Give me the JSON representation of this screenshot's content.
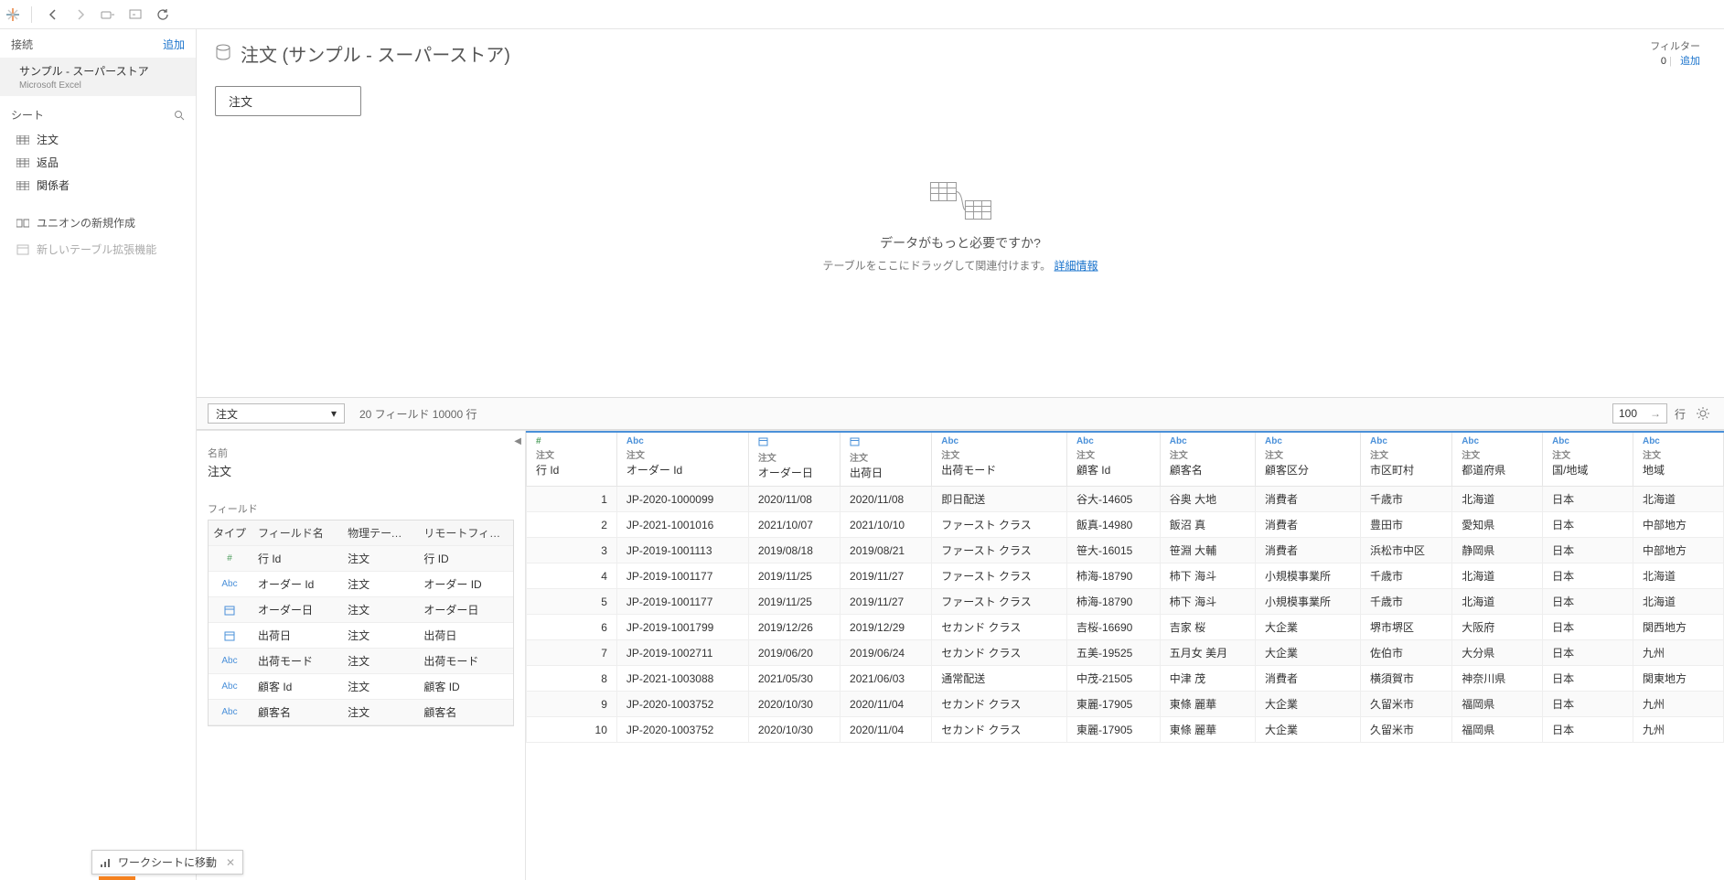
{
  "toolbar": {},
  "sidebar": {
    "connections_label": "接続",
    "add_label": "追加",
    "connection": {
      "name": "サンプル - スーパーストア",
      "type": "Microsoft Excel"
    },
    "sheets_label": "シート",
    "sheets": [
      {
        "label": "注文"
      },
      {
        "label": "返品"
      },
      {
        "label": "関係者"
      }
    ],
    "new_union_label": "ユニオンの新規作成",
    "new_table_ext_label": "新しいテーブル拡張機能"
  },
  "datasource": {
    "title": "注文 (サンプル - スーパーストア)",
    "filter_label": "フィルター",
    "filter_count": "0",
    "filter_add": "追加"
  },
  "canvas": {
    "table_pill": "注文",
    "need_more_q": "データがもっと必要ですか?",
    "need_more_hint_prefix": "テーブルをここにドラッグして関連付けます。",
    "need_more_link": "詳細情報"
  },
  "midbar": {
    "selected_table": "注文",
    "stats": "20 フィールド 10000 行",
    "rows_value": "100",
    "rows_label": "行"
  },
  "lower_left": {
    "name_label": "名前",
    "name_value": "注文",
    "fields_label": "フィールド",
    "headers": {
      "type": "タイプ",
      "name": "フィールド名",
      "phys": "物理テーブル",
      "remote": "リモートフィールド名"
    },
    "rows": [
      {
        "type": "num",
        "icon": "#",
        "name": "行 Id",
        "phys": "注文",
        "remote": "行 ID"
      },
      {
        "type": "str",
        "icon": "Abc",
        "name": "オーダー Id",
        "phys": "注文",
        "remote": "オーダー ID"
      },
      {
        "type": "date",
        "icon": "cal",
        "name": "オーダー日",
        "phys": "注文",
        "remote": "オーダー日"
      },
      {
        "type": "date",
        "icon": "cal",
        "name": "出荷日",
        "phys": "注文",
        "remote": "出荷日"
      },
      {
        "type": "str",
        "icon": "Abc",
        "name": "出荷モード",
        "phys": "注文",
        "remote": "出荷モード"
      },
      {
        "type": "str",
        "icon": "Abc",
        "name": "顧客 Id",
        "phys": "注文",
        "remote": "顧客 ID"
      },
      {
        "type": "str",
        "icon": "Abc",
        "name": "顧客名",
        "phys": "注文",
        "remote": "顧客名"
      }
    ]
  },
  "grid": {
    "src_label": "注文",
    "columns": [
      {
        "key": "row_id",
        "type": "#",
        "name": "行 Id",
        "numeric": true
      },
      {
        "key": "order_id",
        "type": "Abc",
        "name": "オーダー Id"
      },
      {
        "key": "order_dt",
        "type": "cal",
        "name": "オーダー日"
      },
      {
        "key": "ship_dt",
        "type": "cal",
        "name": "出荷日"
      },
      {
        "key": "ship_md",
        "type": "Abc",
        "name": "出荷モード"
      },
      {
        "key": "cust_id",
        "type": "Abc",
        "name": "顧客 Id"
      },
      {
        "key": "cust_nm",
        "type": "Abc",
        "name": "顧客名"
      },
      {
        "key": "cust_seg",
        "type": "Abc",
        "name": "顧客区分"
      },
      {
        "key": "city",
        "type": "Abc",
        "name": "市区町村"
      },
      {
        "key": "pref",
        "type": "Abc",
        "name": "都道府県"
      },
      {
        "key": "country",
        "type": "Abc",
        "name": "国/地域"
      },
      {
        "key": "region",
        "type": "Abc",
        "name": "地域"
      }
    ],
    "rows": [
      {
        "row_id": "1",
        "order_id": "JP-2020-1000099",
        "order_dt": "2020/11/08",
        "ship_dt": "2020/11/08",
        "ship_md": "即日配送",
        "cust_id": "谷大-14605",
        "cust_nm": "谷奥 大地",
        "cust_seg": "消費者",
        "city": "千歳市",
        "pref": "北海道",
        "country": "日本",
        "region": "北海道"
      },
      {
        "row_id": "2",
        "order_id": "JP-2021-1001016",
        "order_dt": "2021/10/07",
        "ship_dt": "2021/10/10",
        "ship_md": "ファースト クラス",
        "cust_id": "飯真-14980",
        "cust_nm": "飯沼 真",
        "cust_seg": "消費者",
        "city": "豊田市",
        "pref": "愛知県",
        "country": "日本",
        "region": "中部地方"
      },
      {
        "row_id": "3",
        "order_id": "JP-2019-1001113",
        "order_dt": "2019/08/18",
        "ship_dt": "2019/08/21",
        "ship_md": "ファースト クラス",
        "cust_id": "笹大-16015",
        "cust_nm": "笹淵 大輔",
        "cust_seg": "消費者",
        "city": "浜松市中区",
        "pref": "静岡県",
        "country": "日本",
        "region": "中部地方"
      },
      {
        "row_id": "4",
        "order_id": "JP-2019-1001177",
        "order_dt": "2019/11/25",
        "ship_dt": "2019/11/27",
        "ship_md": "ファースト クラス",
        "cust_id": "柿海-18790",
        "cust_nm": "柿下 海斗",
        "cust_seg": "小規模事業所",
        "city": "千歳市",
        "pref": "北海道",
        "country": "日本",
        "region": "北海道"
      },
      {
        "row_id": "5",
        "order_id": "JP-2019-1001177",
        "order_dt": "2019/11/25",
        "ship_dt": "2019/11/27",
        "ship_md": "ファースト クラス",
        "cust_id": "柿海-18790",
        "cust_nm": "柿下 海斗",
        "cust_seg": "小規模事業所",
        "city": "千歳市",
        "pref": "北海道",
        "country": "日本",
        "region": "北海道"
      },
      {
        "row_id": "6",
        "order_id": "JP-2019-1001799",
        "order_dt": "2019/12/26",
        "ship_dt": "2019/12/29",
        "ship_md": "セカンド クラス",
        "cust_id": "吉桜-16690",
        "cust_nm": "吉家 桜",
        "cust_seg": "大企業",
        "city": "堺市堺区",
        "pref": "大阪府",
        "country": "日本",
        "region": "関西地方"
      },
      {
        "row_id": "7",
        "order_id": "JP-2019-1002711",
        "order_dt": "2019/06/20",
        "ship_dt": "2019/06/24",
        "ship_md": "セカンド クラス",
        "cust_id": "五美-19525",
        "cust_nm": "五月女 美月",
        "cust_seg": "大企業",
        "city": "佐伯市",
        "pref": "大分県",
        "country": "日本",
        "region": "九州"
      },
      {
        "row_id": "8",
        "order_id": "JP-2021-1003088",
        "order_dt": "2021/05/30",
        "ship_dt": "2021/06/03",
        "ship_md": "通常配送",
        "cust_id": "中茂-21505",
        "cust_nm": "中津 茂",
        "cust_seg": "消費者",
        "city": "横須賀市",
        "pref": "神奈川県",
        "country": "日本",
        "region": "関東地方"
      },
      {
        "row_id": "9",
        "order_id": "JP-2020-1003752",
        "order_dt": "2020/10/30",
        "ship_dt": "2020/11/04",
        "ship_md": "セカンド クラス",
        "cust_id": "東麗-17905",
        "cust_nm": "東條 麗華",
        "cust_seg": "大企業",
        "city": "久留米市",
        "pref": "福岡県",
        "country": "日本",
        "region": "九州"
      },
      {
        "row_id": "10",
        "order_id": "JP-2020-1003752",
        "order_dt": "2020/10/30",
        "ship_dt": "2020/11/04",
        "ship_md": "セカンド クラス",
        "cust_id": "東麗-17905",
        "cust_nm": "東條 麗華",
        "cust_seg": "大企業",
        "city": "久留米市",
        "pref": "福岡県",
        "country": "日本",
        "region": "九州"
      }
    ]
  },
  "bottom_tip": "ワークシートに移動"
}
